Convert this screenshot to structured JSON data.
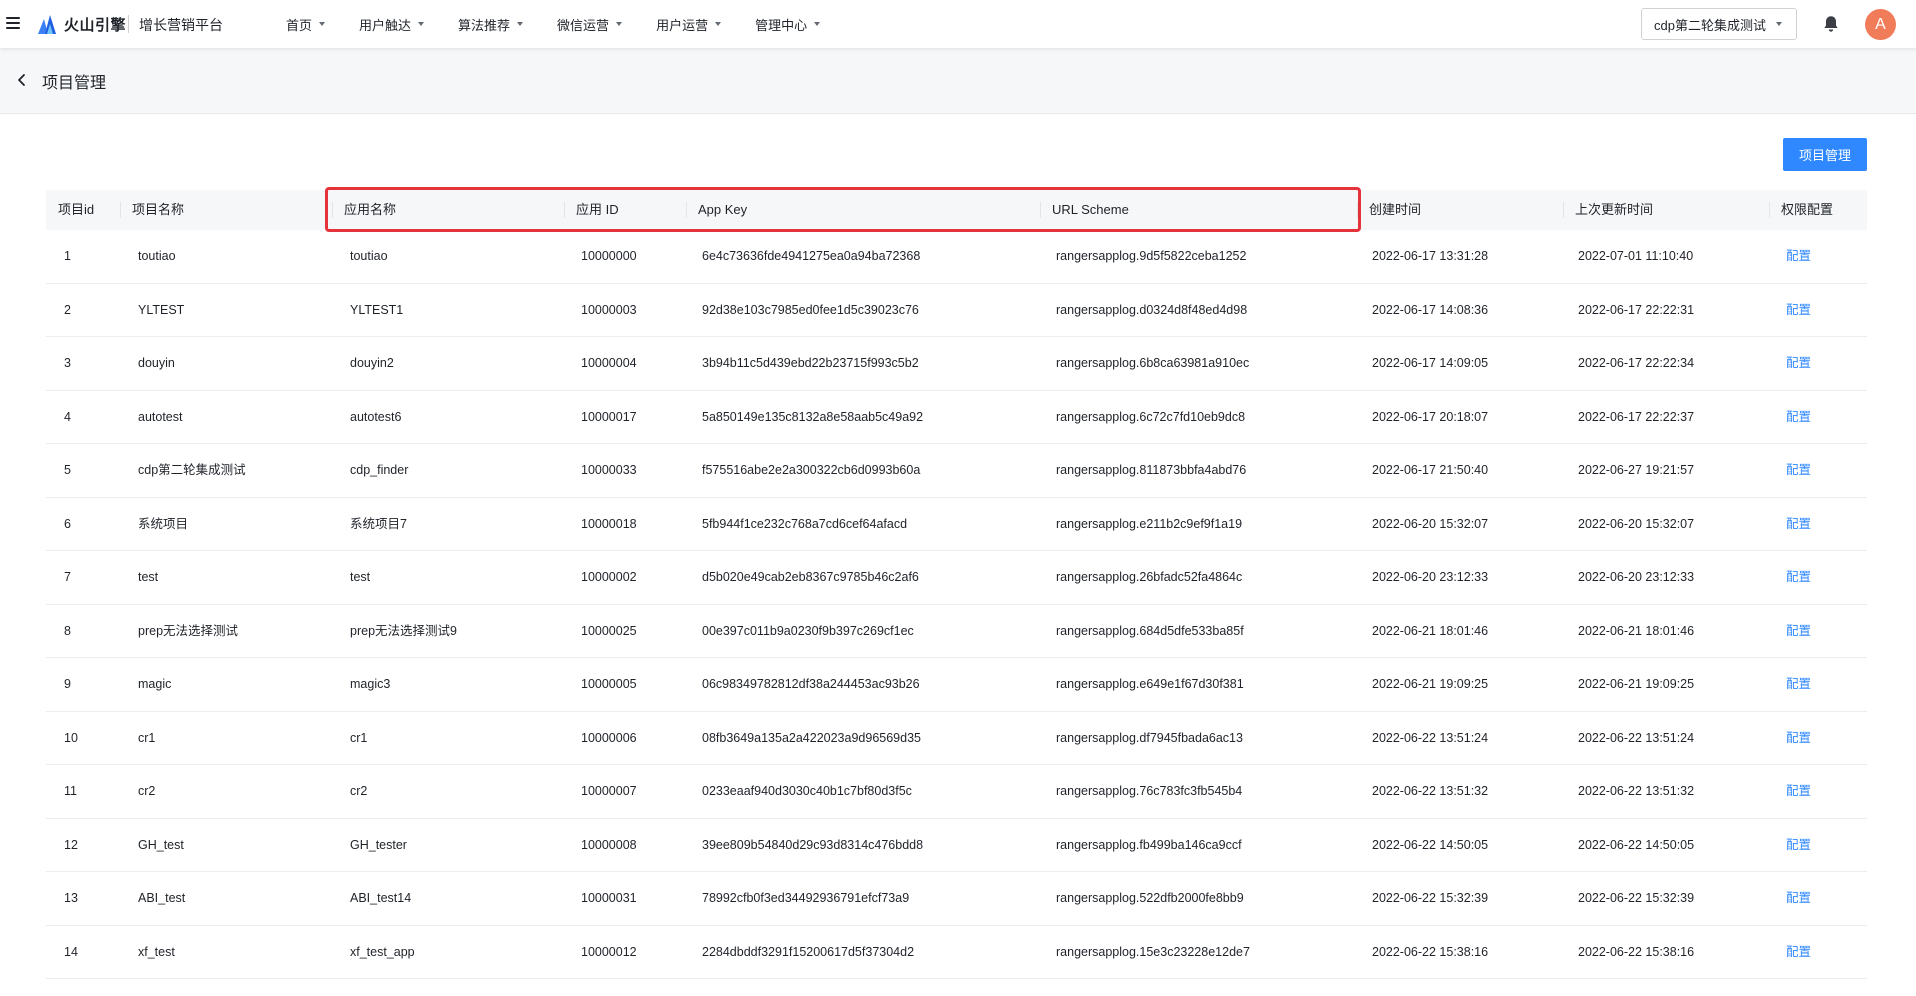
{
  "header": {
    "brand": "火山引擎",
    "platform": "增长营销平台",
    "nav": [
      "首页",
      "用户触达",
      "算法推荐",
      "微信运营",
      "用户运营",
      "管理中心"
    ],
    "project_select": "cdp第二轮集成测试",
    "avatar_letter": "A",
    "icons": [
      "menu-icon",
      "volcano-logo-icon",
      "bell-icon",
      "caret-down-icon"
    ]
  },
  "page": {
    "title": "项目管理",
    "action_button": "项目管理"
  },
  "table": {
    "columns": [
      "项目id",
      "项目名称",
      "应用名称",
      "应用 ID",
      "App Key",
      "URL Scheme",
      "创建时间",
      "上次更新时间",
      "权限配置"
    ],
    "rows": [
      [
        "1",
        "toutiao",
        "toutiao",
        "10000000",
        "6e4c73636fde4941275ea0a94ba72368",
        "rangersapplog.9d5f5822ceba1252",
        "2022-06-17 13:31:28",
        "2022-07-01 11:10:40",
        "配置"
      ],
      [
        "2",
        "YLTEST",
        "YLTEST1",
        "10000003",
        "92d38e103c7985ed0fee1d5c39023c76",
        "rangersapplog.d0324d8f48ed4d98",
        "2022-06-17 14:08:36",
        "2022-06-17 22:22:31",
        "配置"
      ],
      [
        "3",
        "douyin",
        "douyin2",
        "10000004",
        "3b94b11c5d439ebd22b23715f993c5b2",
        "rangersapplog.6b8ca63981a910ec",
        "2022-06-17 14:09:05",
        "2022-06-17 22:22:34",
        "配置"
      ],
      [
        "4",
        "autotest",
        "autotest6",
        "10000017",
        "5a850149e135c8132a8e58aab5c49a92",
        "rangersapplog.6c72c7fd10eb9dc8",
        "2022-06-17 20:18:07",
        "2022-06-17 22:22:37",
        "配置"
      ],
      [
        "5",
        "cdp第二轮集成测试",
        "cdp_finder",
        "10000033",
        "f575516abe2e2a300322cb6d0993b60a",
        "rangersapplog.811873bbfa4abd76",
        "2022-06-17 21:50:40",
        "2022-06-27 19:21:57",
        "配置"
      ],
      [
        "6",
        "系统项目",
        "系统项目7",
        "10000018",
        "5fb944f1ce232c768a7cd6cef64afacd",
        "rangersapplog.e211b2c9ef9f1a19",
        "2022-06-20 15:32:07",
        "2022-06-20 15:32:07",
        "配置"
      ],
      [
        "7",
        "test",
        "test",
        "10000002",
        "d5b020e49cab2eb8367c9785b46c2af6",
        "rangersapplog.26bfadc52fa4864c",
        "2022-06-20 23:12:33",
        "2022-06-20 23:12:33",
        "配置"
      ],
      [
        "8",
        "prep无法选择测试",
        "prep无法选择测试9",
        "10000025",
        "00e397c011b9a0230f9b397c269cf1ec",
        "rangersapplog.684d5dfe533ba85f",
        "2022-06-21 18:01:46",
        "2022-06-21 18:01:46",
        "配置"
      ],
      [
        "9",
        "magic",
        "magic3",
        "10000005",
        "06c98349782812df38a244453ac93b26",
        "rangersapplog.e649e1f67d30f381",
        "2022-06-21 19:09:25",
        "2022-06-21 19:09:25",
        "配置"
      ],
      [
        "10",
        "cr1",
        "cr1",
        "10000006",
        "08fb3649a135a2a422023a9d96569d35",
        "rangersapplog.df7945fbada6ac13",
        "2022-06-22 13:51:24",
        "2022-06-22 13:51:24",
        "配置"
      ],
      [
        "11",
        "cr2",
        "cr2",
        "10000007",
        "0233eaaf940d3030c40b1c7bf80d3f5c",
        "rangersapplog.76c783fc3fb545b4",
        "2022-06-22 13:51:32",
        "2022-06-22 13:51:32",
        "配置"
      ],
      [
        "12",
        "GH_test",
        "GH_tester",
        "10000008",
        "39ee809b54840d29c93d8314c476bdd8",
        "rangersapplog.fb499ba146ca9ccf",
        "2022-06-22 14:50:05",
        "2022-06-22 14:50:05",
        "配置"
      ],
      [
        "13",
        "ABI_test",
        "ABI_test14",
        "10000031",
        "78992cfb0f3ed34492936791efcf73a9",
        "rangersapplog.522dfb2000fe8bb9",
        "2022-06-22 15:32:39",
        "2022-06-22 15:32:39",
        "配置"
      ],
      [
        "14",
        "xf_test",
        "xf_test_app",
        "10000012",
        "2284dbddf3291f15200617d5f37304d2",
        "rangersapplog.15e3c23228e12de7",
        "2022-06-22 15:38:16",
        "2022-06-22 15:38:16",
        "配置"
      ]
    ]
  },
  "colors": {
    "accent": "#2f88ff",
    "highlight_box": "#e5333c",
    "avatar_bg": "#f07c5a"
  }
}
